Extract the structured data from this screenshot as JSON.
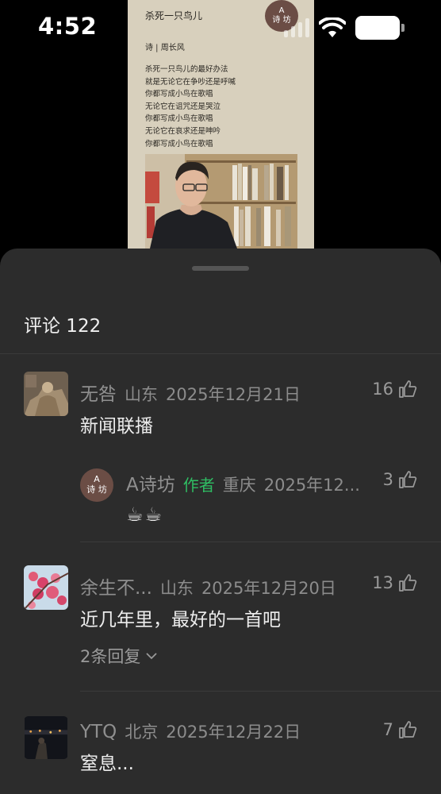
{
  "status_bar": {
    "time": "4:52"
  },
  "post_image": {
    "title": "杀死一只鸟儿",
    "author_line": "诗 | 周长风",
    "lines": [
      "杀死一只鸟儿的最好办法",
      "就是无论它在争吵还是呼喊",
      "你都写成小鸟在歌唱",
      "无论它在诅咒还是哭泣",
      "你都写成小鸟在歌唱",
      "无论它在哀求还是呻吟",
      "你都写成小鸟在歌唱"
    ],
    "logo_line1": "A",
    "logo_line2": "诗 坊"
  },
  "sheet": {
    "title": "评论 122"
  },
  "comments": [
    {
      "name": "无咎",
      "region": "山东",
      "date": "2025年12月21日",
      "likes": "16",
      "text": "新闻联播",
      "reply": {
        "name": "A诗坊",
        "tag": "作者",
        "region": "重庆",
        "date": "2025年12...",
        "likes": "3",
        "text": "☕☕",
        "avatar_line1": "A",
        "avatar_line2": "诗 坊"
      }
    },
    {
      "name": "余生不...",
      "region": "山东",
      "date": "2025年12月20日",
      "likes": "13",
      "text": "近几年里，最好的一首吧",
      "replies_label": "2条回复"
    },
    {
      "name": "YTQ",
      "region": "北京",
      "date": "2025年12月22日",
      "likes": "7",
      "text": "窒息..."
    }
  ]
}
